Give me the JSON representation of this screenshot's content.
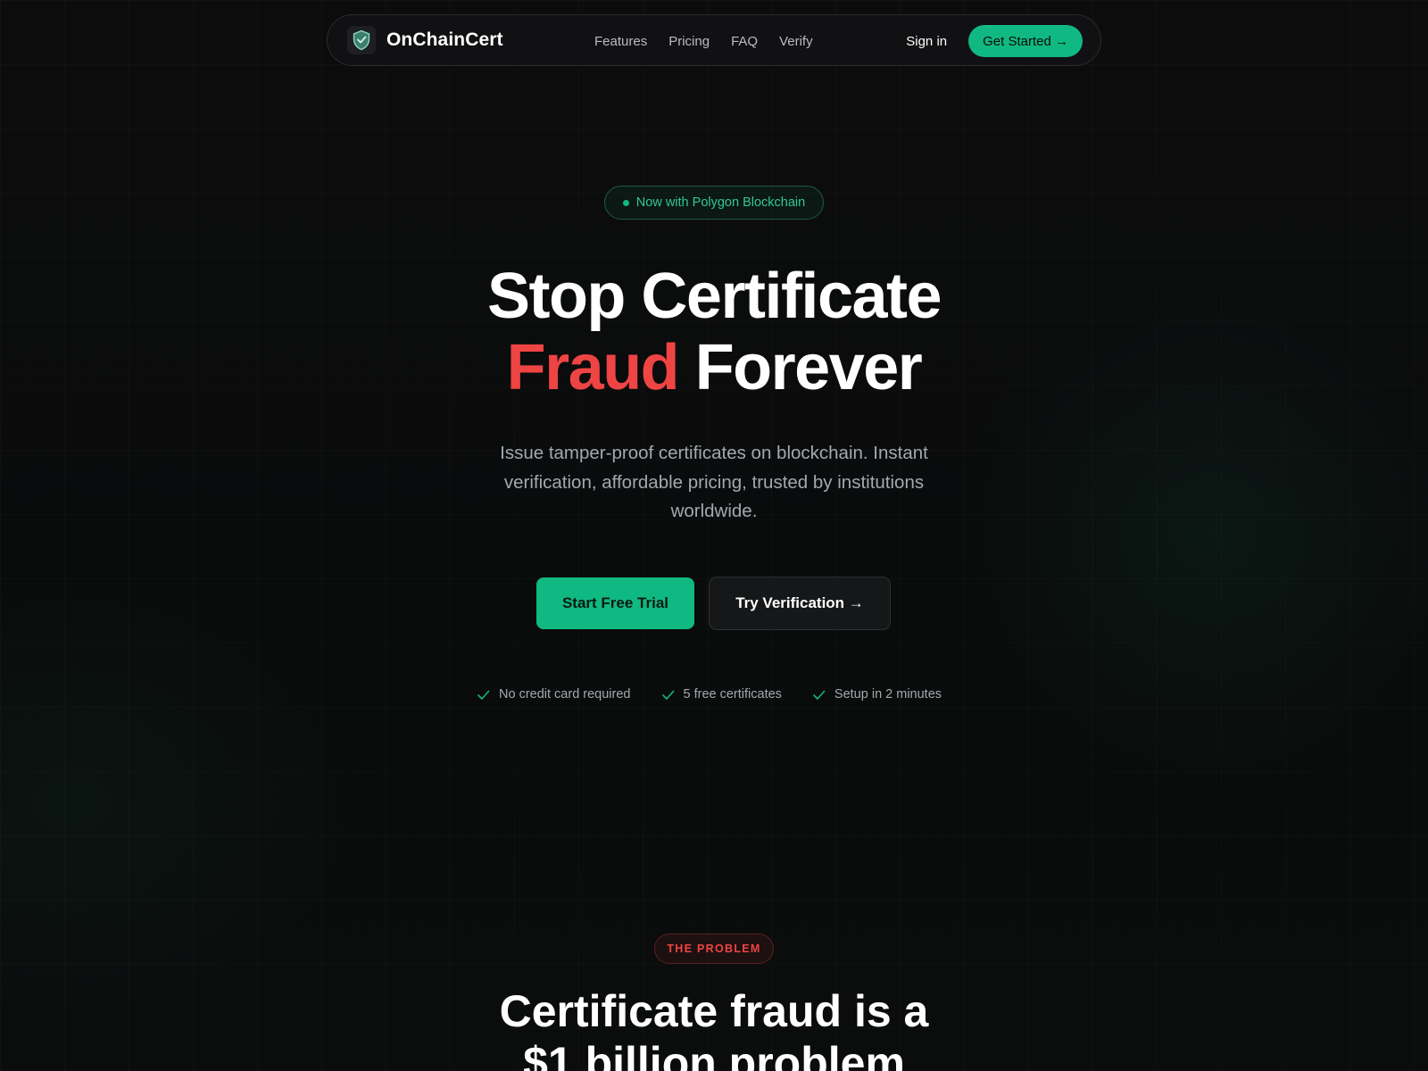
{
  "nav": {
    "brand": "OnChainCert",
    "links": [
      "Features",
      "Pricing",
      "FAQ",
      "Verify"
    ],
    "signin": "Sign in",
    "get_started": "Get Started →"
  },
  "hero": {
    "badge": "Now with Polygon Blockchain",
    "title_line1": "Stop Certificate",
    "title_highlight": "Fraud",
    "title_rest": "Forever",
    "subtitle": "Issue tamper-proof certificates on blockchain. Instant verification, affordable pricing, trusted by institutions worldwide.",
    "cta_primary": "Start Free Trial",
    "cta_secondary": "Try Verification →",
    "checks": [
      "No credit card required",
      "5 free certificates",
      "Setup in 2 minutes"
    ]
  },
  "problem": {
    "badge": "THE PROBLEM",
    "title_line1": "Certificate fraud is a",
    "title_line2": "$1 billion problem"
  },
  "colors": {
    "accent": "#10b981",
    "danger": "#ef4444",
    "background": "#0b0b0c"
  },
  "icons": {
    "logo": "shield-icon",
    "check": "check-icon",
    "badge_dot": "dot-icon"
  }
}
